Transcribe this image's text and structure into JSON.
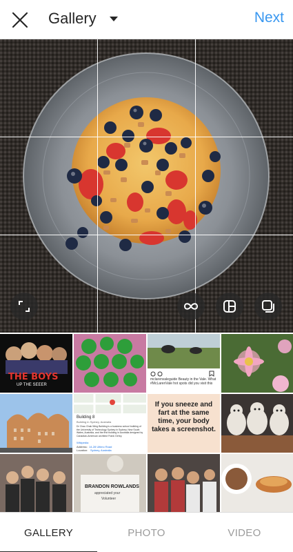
{
  "header": {
    "close_icon": "close-icon",
    "title": "Gallery",
    "dropdown_icon": "caret-down-icon",
    "next_label": "Next",
    "accent_color": "#3897f0"
  },
  "preview": {
    "image": "pancake-with-blueberries-strawberries-nuts",
    "controls": [
      "expand-icon",
      "boomerang-icon",
      "layout-icon",
      "multi-select-icon"
    ]
  },
  "thumbnails": {
    "row1": {
      "t1_title": "THE BOYS",
      "t1_subtitle": "UP THE SEEER"
    },
    "row2": {
      "map_title": "Building 8",
      "map_subtitle": "Building in Sydney, Australia",
      "map_body": "Dr Chau Chak Wing Building is a business school building of the University of Technology Sydney in Sydney, New South Wales, Australia, and the first building in Australia designed by Canadian-American architect Frank Gehry.",
      "map_link": "Wikipedia",
      "map_address_label": "Address:",
      "map_address": "14-28 Ultimo Road",
      "map_location_label": "Location:",
      "map_location": "Sydney, Australia",
      "meme_text": "If you sneeze and fart at the same time, your body takes a screenshot."
    },
    "row1_post": {
      "caption": "mclarenvaleguide Beauty in the Vale. What #McLarenVale hot spots did you visit this"
    },
    "row3": {
      "card_name": "BRANDON ROWLANDS",
      "card_sub": "appreciated your",
      "card_small": "Volunteer"
    }
  },
  "tabs": [
    {
      "label": "GALLERY",
      "active": true
    },
    {
      "label": "PHOTO",
      "active": false
    },
    {
      "label": "VIDEO",
      "active": false
    }
  ]
}
